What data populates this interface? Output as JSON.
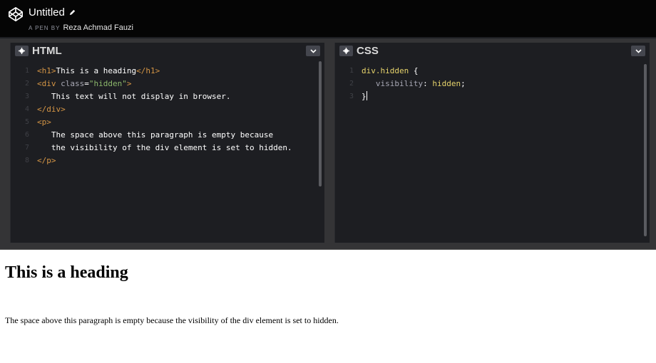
{
  "header": {
    "title": "Untitled",
    "byline_label": "A PEN BY",
    "author": "Reza Achmad Fauzi"
  },
  "html_pane": {
    "title": "HTML",
    "line_numbers": [
      "1",
      "2",
      "3",
      "4",
      "5",
      "6",
      "7",
      "8"
    ],
    "lines": [
      {
        "parts": [
          [
            "tag",
            "<h1>"
          ],
          [
            "plain",
            "This is a heading"
          ],
          [
            "tag",
            "</h1>"
          ]
        ]
      },
      {
        "parts": [
          [
            "tag",
            "<div "
          ],
          [
            "attr",
            "class"
          ],
          [
            "punc",
            "="
          ],
          [
            "str",
            "\"hidden\""
          ],
          [
            "tag",
            ">"
          ]
        ]
      },
      {
        "parts": [
          [
            "plain",
            "   This text will not display in browser."
          ]
        ]
      },
      {
        "parts": [
          [
            "tag",
            "</div>"
          ]
        ]
      },
      {
        "parts": [
          [
            "tag",
            "<p>"
          ]
        ]
      },
      {
        "parts": [
          [
            "plain",
            "   The space above this paragraph is empty because"
          ]
        ]
      },
      {
        "parts": [
          [
            "plain",
            "   the visibility of the div element is set to hidden."
          ]
        ]
      },
      {
        "parts": [
          [
            "tag",
            "</p>"
          ]
        ]
      }
    ]
  },
  "css_pane": {
    "title": "CSS",
    "line_numbers": [
      "1",
      "2",
      "3"
    ],
    "lines": [
      {
        "parts": [
          [
            "sel",
            "div.hidden"
          ],
          [
            "punc",
            " {"
          ]
        ]
      },
      {
        "parts": [
          [
            "prop",
            "   visibility"
          ],
          [
            "punc",
            ": "
          ],
          [
            "val",
            "hidden"
          ],
          [
            "punc",
            ";"
          ]
        ]
      },
      {
        "parts": [
          [
            "punc",
            "}"
          ]
        ],
        "cursor": true
      }
    ]
  },
  "preview": {
    "heading": "This is a heading",
    "paragraph": "The space above this paragraph is empty because the visibility of the div element is set to hidden."
  }
}
